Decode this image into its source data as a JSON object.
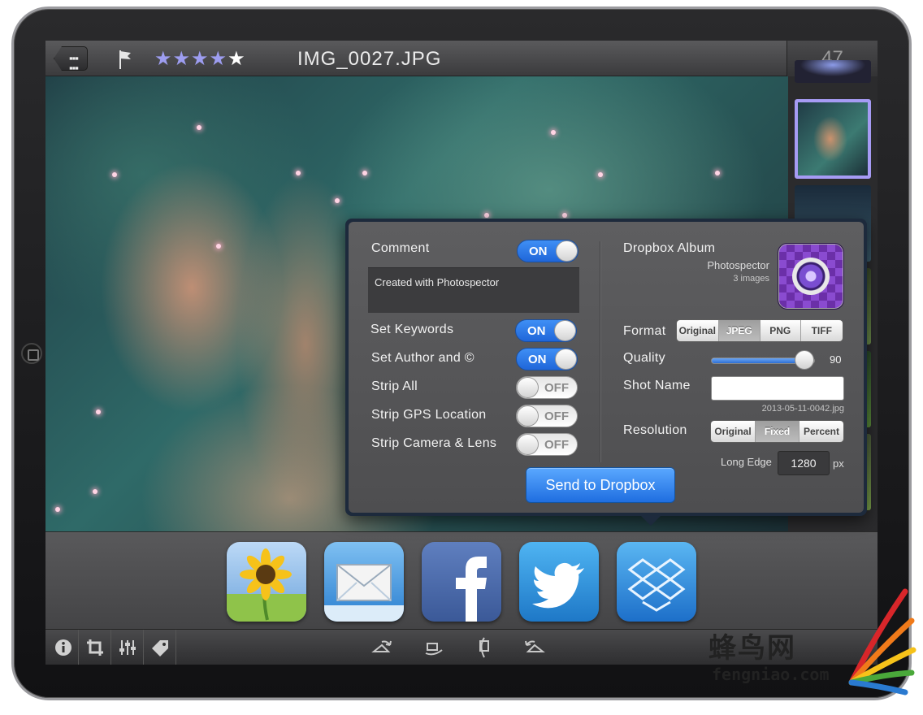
{
  "topbar": {
    "filename": "IMG_0027.JPG",
    "photo_counter": "47",
    "rating": {
      "filled": 4,
      "max": 5,
      "filled_glyphs": "★★★★",
      "empty_glyphs": "★"
    }
  },
  "export_popover": {
    "comment": {
      "label": "Comment",
      "toggle": "ON",
      "text": "Created with Photospector"
    },
    "set_keywords": {
      "label": "Set Keywords",
      "toggle": "ON"
    },
    "set_author": {
      "label": "Set Author and ©",
      "toggle": "ON"
    },
    "strip_all": {
      "label": "Strip All",
      "toggle": "OFF"
    },
    "strip_gps": {
      "label": "Strip GPS Location",
      "toggle": "OFF"
    },
    "strip_camera": {
      "label": "Strip Camera & Lens",
      "toggle": "OFF"
    },
    "dropbox_album": {
      "label": "Dropbox Album",
      "name": "Photospector",
      "count": "3 images"
    },
    "format": {
      "label": "Format",
      "options": [
        "Original",
        "JPEG",
        "PNG",
        "TIFF"
      ],
      "selected": "JPEG"
    },
    "quality": {
      "label": "Quality",
      "value": "90",
      "level": 0.9
    },
    "shot_name": {
      "label": "Shot Name",
      "value": "",
      "hint": "2013-05-11-0042.jpg"
    },
    "resolution": {
      "label": "Resolution",
      "options": [
        "Original",
        "Fixed",
        "Percent"
      ],
      "selected": "Fixed"
    },
    "long_edge": {
      "label": "Long Edge",
      "value": "1280",
      "unit": "px"
    },
    "send_button": "Send to Dropbox"
  },
  "share_targets": [
    "photos-icon",
    "mail-icon",
    "facebook-icon",
    "twitter-icon",
    "dropbox-icon"
  ],
  "toolbar_icons": [
    "info-icon",
    "crop-icon",
    "adjust-icon",
    "tag-icon",
    "rotate-left-icon",
    "flip-horizontal-icon",
    "flip-vertical-icon",
    "rotate-right-icon"
  ],
  "watermark": {
    "brand": "蜂鸟网",
    "site": "fengniao.com"
  },
  "colors": {
    "accent_blue": "#1f6ee0",
    "rating_star": "#9d9df0",
    "selected_thumb": "#a69bf4"
  }
}
